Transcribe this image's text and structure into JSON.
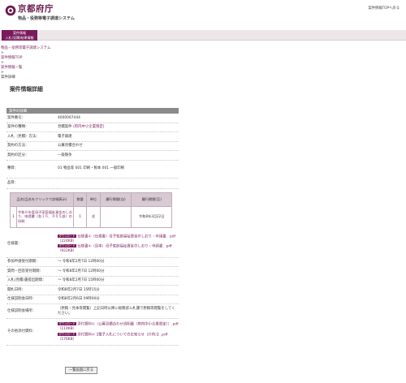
{
  "header": {
    "logo_title": "京都府庁",
    "logo_sub": "物品・役務等電子調達システム",
    "top_link": "案件情報TOPへ戻る"
  },
  "gnav": {
    "tab_line1": "案件情報",
    "tab_line2": "入札(見積)結果情報"
  },
  "breadcrumb": {
    "items": [
      "物品・役務等電子調達システム",
      ">",
      "案件情報TOP",
      ">",
      "案件情報一覧",
      ">",
      "案件詳細"
    ]
  },
  "page_title": "案件情報詳細",
  "detail": {
    "heading": "案件の詳細",
    "rows": [
      {
        "k": "案件番号：",
        "v": "4000067444"
      },
      {
        "k": "案件の種類：",
        "v": "見積案件 ",
        "v2": "(府内中小企業限定)"
      },
      {
        "k": "入札（見積）方法：",
        "v": "電子調達"
      },
      {
        "k": "契約の方法：",
        "v": "公募見積合わせ"
      },
      {
        "k": "契約の区分：",
        "v": "一般競争"
      },
      {
        "k": "種目：",
        "v": "01 物品等 001 印刷・製本 001 一般印刷"
      },
      {
        "k": "品目：",
        "v": ""
      }
    ],
    "items_table": {
      "headers": [
        "品名(品名をクリックで詳細表示)",
        "数量",
        "単位",
        "履行期間(自)",
        "履行期間(至)"
      ],
      "rows": [
        [
          "1",
          "令和８年度母子家庭福祉資金のしおり、申請書（各１６、００５部）の印刷",
          "1",
          "式",
          "",
          "令和8年3月22日"
        ]
      ]
    },
    "rows2": [
      {
        "k": "仕様書：",
        "files": [
          {
            "badge": "ダウンロード",
            "t": "仕様書①（仕様書）母子家庭福祉資金のしおり・申請書．pdf（224KB）"
          },
          {
            "badge": "ダウンロード",
            "t": "仕様書②（見本）母子家庭福祉資金のしおり・申請書．pdf（922KB）"
          }
        ]
      },
      {
        "k": "参加申請受付期間：",
        "v": "～ 令和8年2月7日 12時00分"
      },
      {
        "k": "質問・回答受付期間：",
        "v": "～ 令和8年2月7日 12時00分"
      },
      {
        "k": "入札(見積)書提出期間：",
        "v": "～ 令和8年2月7日 15時00分"
      },
      {
        "k": "開札日時：",
        "v": "令和8年2月7日 15時15分"
      },
      {
        "k": "仕様説明会日時：",
        "v": "令和8年2月6日 09時00分"
      },
      {
        "k": "仕様説明会場所：",
        "v": "（原稿・見本等閲覧）上記日時以降に総務部入札課で原稿等閲覧をしてください。"
      },
      {
        "k": "その他添付資料：",
        "files": [
          {
            "badge": "ダウンロード",
            "t": "添付資料①（公募見積合わせ説明書（府内中小企業限定））.pdf（114KB）"
          },
          {
            "badge": "ダウンロード",
            "t": "添付資料②【電子入札についてのお知らせ（庁内）】.pdf（176KB）"
          }
        ]
      }
    ]
  },
  "back_button": "一覧画面に戻る",
  "colors": {
    "brand": "#7a1a5c",
    "section_header": "#8a8a8a",
    "table_header": "#d9c9d3"
  }
}
